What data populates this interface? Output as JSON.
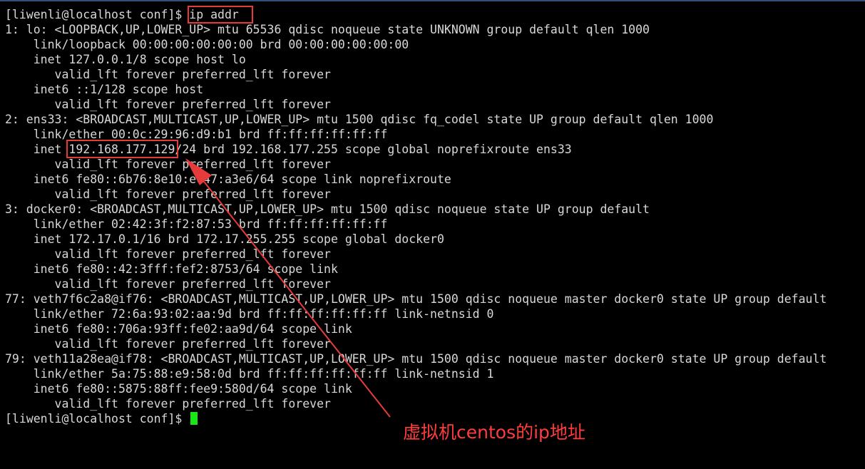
{
  "terminal": {
    "lines": [
      "[liwenli@localhost conf]$ ip addr",
      "1: lo: <LOOPBACK,UP,LOWER_UP> mtu 65536 qdisc noqueue state UNKNOWN group default qlen 1000",
      "    link/loopback 00:00:00:00:00:00 brd 00:00:00:00:00:00",
      "    inet 127.0.0.1/8 scope host lo",
      "       valid_lft forever preferred_lft forever",
      "    inet6 ::1/128 scope host",
      "       valid_lft forever preferred_lft forever",
      "2: ens33: <BROADCAST,MULTICAST,UP,LOWER_UP> mtu 1500 qdisc fq_codel state UP group default qlen 1000",
      "    link/ether 00:0c:29:96:d9:b1 brd ff:ff:ff:ff:ff:ff",
      "    inet 192.168.177.129/24 brd 192.168.177.255 scope global noprefixroute ens33",
      "       valid_lft forever preferred_lft forever",
      "    inet6 fe80::6b76:8e10:e047:a3e6/64 scope link noprefixroute",
      "       valid_lft forever preferred_lft forever",
      "3: docker0: <BROADCAST,MULTICAST,UP,LOWER_UP> mtu 1500 qdisc noqueue state UP group default",
      "    link/ether 02:42:3f:f2:87:53 brd ff:ff:ff:ff:ff:ff",
      "    inet 172.17.0.1/16 brd 172.17.255.255 scope global docker0",
      "       valid_lft forever preferred_lft forever",
      "    inet6 fe80::42:3fff:fef2:8753/64 scope link",
      "       valid_lft forever preferred_lft forever",
      "77: veth7f6c2a8@if76: <BROADCAST,MULTICAST,UP,LOWER_UP> mtu 1500 qdisc noqueue master docker0 state UP group default",
      "    link/ether 72:6a:93:02:aa:9d brd ff:ff:ff:ff:ff:ff link-netnsid 0",
      "    inet6 fe80::706a:93ff:fe02:aa9d/64 scope link",
      "       valid_lft forever preferred_lft forever",
      "79: veth11a28ea@if78: <BROADCAST,MULTICAST,UP,LOWER_UP> mtu 1500 qdisc noqueue master docker0 state UP group default",
      "    link/ether 5a:75:88:e9:58:0d brd ff:ff:ff:ff:ff:ff link-netnsid 1",
      "    inet6 fe80::5875:88ff:fee9:580d/64 scope link",
      "       valid_lft forever preferred_lft forever",
      "[liwenli@localhost conf]$ "
    ]
  },
  "annotation": {
    "text": "虚拟机centos的ip地址"
  },
  "colors": {
    "background": "#000000",
    "text": "#d8d8d8",
    "cursor": "#19e619",
    "highlight": "#e53b3b",
    "annotation": "#ff3c3c"
  }
}
